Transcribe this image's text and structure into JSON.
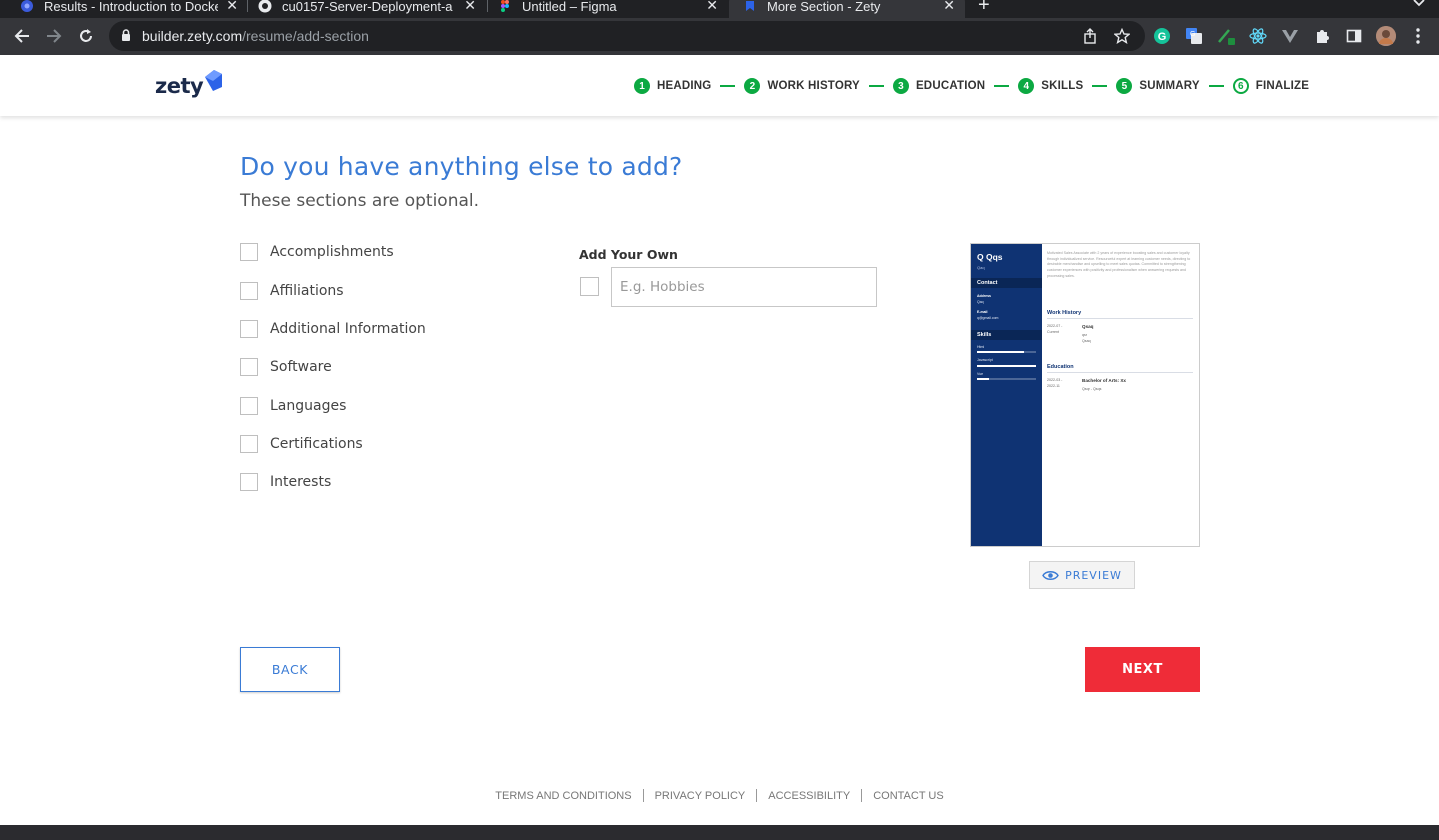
{
  "browser": {
    "tabs": [
      {
        "title": "Results - Introduction to Docke",
        "icon": "docker-favicon-icon",
        "active": false
      },
      {
        "title": "cu0157-Server-Deployment-a",
        "icon": "github-favicon-icon",
        "active": false
      },
      {
        "title": "Untitled – Figma",
        "icon": "figma-favicon-icon",
        "active": false
      },
      {
        "title": "More Section - Zety",
        "icon": "zety-favicon-icon",
        "active": true
      }
    ],
    "url_host": "builder.zety.com",
    "url_path": "/resume/add-section"
  },
  "header": {
    "logo_text": "zety",
    "steps": [
      {
        "num": "1",
        "label": "HEADING"
      },
      {
        "num": "2",
        "label": "WORK HISTORY"
      },
      {
        "num": "3",
        "label": "EDUCATION"
      },
      {
        "num": "4",
        "label": "SKILLS"
      },
      {
        "num": "5",
        "label": "SUMMARY"
      },
      {
        "num": "6",
        "label": "FINALIZE"
      }
    ]
  },
  "main": {
    "title": "Do you have anything else to add?",
    "subtitle": "These sections are optional.",
    "sections": [
      "Accomplishments",
      "Affiliations",
      "Additional Information",
      "Software",
      "Languages",
      "Certifications",
      "Interests"
    ],
    "add_own_label": "Add Your Own",
    "add_own_placeholder": "E.g. Hobbies",
    "preview_label": "PREVIEW",
    "back_label": "BACK",
    "next_label": "NEXT"
  },
  "resume": {
    "name": "Q Qqs",
    "name_sub": "Qaq",
    "contact_heading": "Contact",
    "address_label": "Address",
    "address_value": "Qaq",
    "email_label": "E-mail",
    "email_value": "q@gmail.com",
    "skills_heading": "Skills",
    "skills": [
      {
        "name": "Html",
        "level": 0.8
      },
      {
        "name": "Javascript",
        "level": 1.0
      },
      {
        "name": "Vue",
        "level": 0.2
      }
    ],
    "summary": "Motivated Sales Associate with 2 years of experience boosting sales and customer loyalty through individualized service. Resourceful expert at learning customer needs, directing to desirable merchandise and upselling to meet sales quotas. Committed to strengthening customer experiences with positivity and professionalism when answering requests and processing sales.",
    "work_heading": "Work History",
    "work_dates_1": "2022-07 -",
    "work_dates_2": "Current",
    "work_title": "Qsaq",
    "work_line1": "qsr",
    "work_line2": "Qsaq",
    "education_heading": "Education",
    "edu_dates_1": "2022-03 -",
    "edu_dates_2": "2022-11",
    "edu_degree": "Bachelor of Arts: Xx",
    "edu_school": "Qsqr - Qsqs"
  },
  "footer": {
    "links": [
      "TERMS AND CONDITIONS",
      "PRIVACY POLICY",
      "ACCESSIBILITY",
      "CONTACT US"
    ]
  },
  "colors": {
    "accent_blue": "#3a7bd5",
    "step_green": "#0ca942",
    "next_red": "#ef2c38",
    "resume_navy": "#0f3373"
  }
}
